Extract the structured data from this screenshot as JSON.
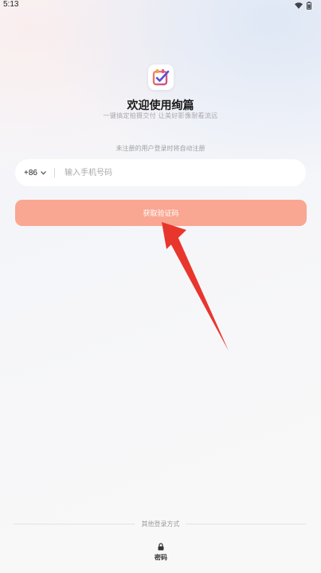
{
  "status_bar": {
    "time": "5:13"
  },
  "app": {
    "title": "欢迎使用绚篇",
    "subtitle": "一键搞定拍摄交付 让美好影像耐看流远",
    "logo_icon": "checkbox-logo-icon"
  },
  "login": {
    "hint": "未注册的用户登录时将自动注册",
    "country_code": "+86",
    "phone_placeholder": "输入手机号码",
    "get_code_label": "获取验证码",
    "button_color": "#f9a792"
  },
  "footer": {
    "other_methods_label": "其他登录方式",
    "password_login_label": "密码"
  },
  "annotation": {
    "arrow_color": "#e8362d"
  }
}
